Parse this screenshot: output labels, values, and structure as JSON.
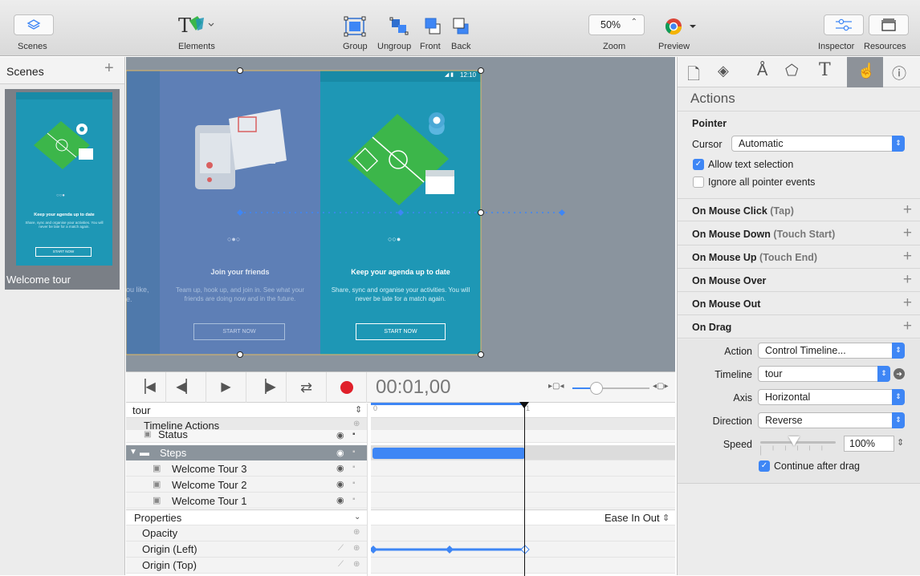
{
  "toolbar": {
    "scenes_label": "Scenes",
    "elements_label": "Elements",
    "group_label": "Group",
    "ungroup_label": "Ungroup",
    "front_label": "Front",
    "back_label": "Back",
    "zoom_value": "50%",
    "zoom_label": "Zoom",
    "preview_label": "Preview",
    "inspector_label": "Inspector",
    "resources_label": "Resources"
  },
  "scenes": {
    "title": "Scenes",
    "add": "+",
    "scene_name": "Welcome tour",
    "thumb_heading": "Keep your agenda up to date",
    "thumb_body": "Share, sync and organise your activities. You will never be late for a match again.",
    "thumb_button": "START NOW"
  },
  "canvas": {
    "status_time": "12:10",
    "left_partial_text": "ou like,",
    "left_partial_text2": "e.",
    "screen1_title": "Join your friends",
    "screen1_body": "Team up, hook up, and join in. See what your friends are doing now and in the future.",
    "screen1_button": "START NOW",
    "screen2_title": "Keep your agenda up to date",
    "screen2_body": "Share, sync and organise your activities. You will never be late for a match again.",
    "screen2_button": "START NOW"
  },
  "timeline": {
    "time": "00:01,00",
    "timeline_name": "tour",
    "ruler_0": "0",
    "ruler_1": "1",
    "rows": {
      "actions": "Timeline Actions",
      "status": "Status",
      "steps": "Steps",
      "wt3": "Welcome Tour 3",
      "wt2": "Welcome Tour 2",
      "wt1": "Welcome Tour 1"
    },
    "properties_label": "Properties",
    "easing": "Ease In Out",
    "props": [
      "Opacity",
      "Origin (Left)",
      "Origin (Top)"
    ]
  },
  "inspector": {
    "title": "Actions",
    "pointer_heading": "Pointer",
    "cursor_label": "Cursor",
    "cursor_value": "Automatic",
    "allow_text": "Allow text selection",
    "allow_text_checked": true,
    "ignore_pointer": "Ignore all pointer events",
    "ignore_pointer_checked": false,
    "events": [
      {
        "name": "On Mouse Click",
        "alt": "(Tap)"
      },
      {
        "name": "On Mouse Down",
        "alt": "(Touch Start)"
      },
      {
        "name": "On Mouse Up",
        "alt": "(Touch End)"
      },
      {
        "name": "On Mouse Over",
        "alt": ""
      },
      {
        "name": "On Mouse Out",
        "alt": ""
      },
      {
        "name": "On Drag",
        "alt": ""
      }
    ],
    "plus": "+",
    "drag": {
      "action_label": "Action",
      "action_value": "Control Timeline...",
      "timeline_label": "Timeline",
      "timeline_value": "tour",
      "axis_label": "Axis",
      "axis_value": "Horizontal",
      "direction_label": "Direction",
      "direction_value": "Reverse",
      "speed_label": "Speed",
      "speed_value": "100%",
      "speed_level": 0.45,
      "continue": "Continue after drag",
      "continue_checked": true
    }
  },
  "colors": {
    "accent": "#3e86f5",
    "phone_teal": "#1e97b5",
    "phone_faded": "#5e7fb6",
    "record_red": "#e0202a"
  }
}
